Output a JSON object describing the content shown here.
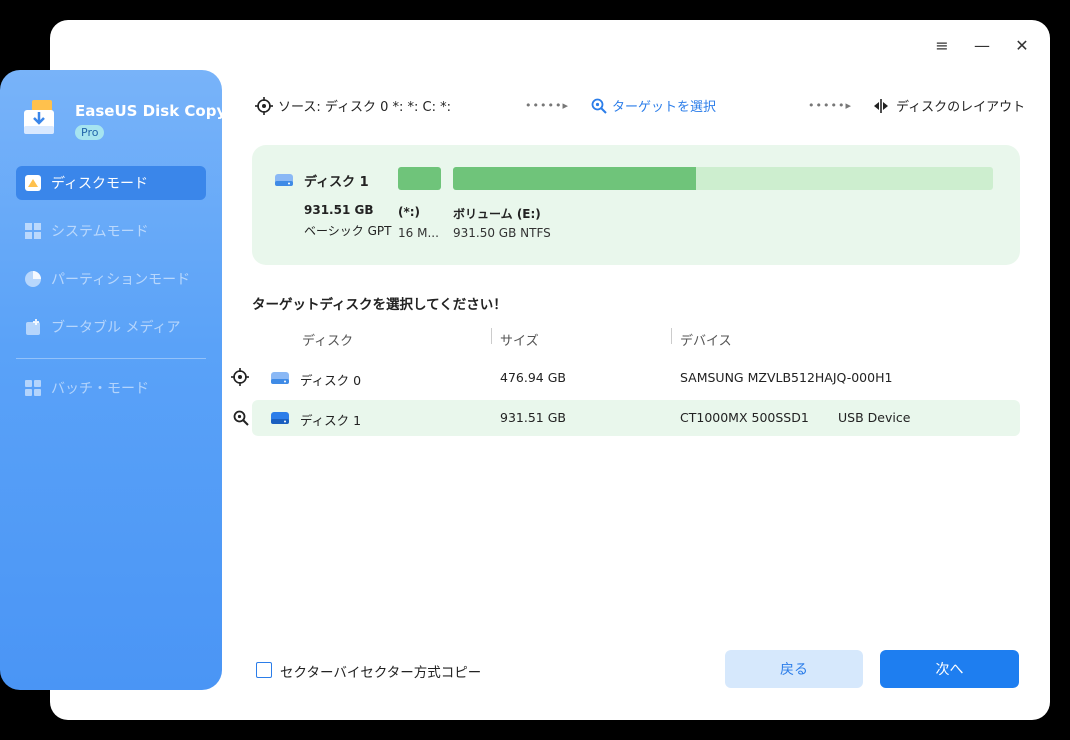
{
  "app": {
    "name": "EaseUS Disk Copy",
    "badge": "Pro"
  },
  "nav": {
    "items": [
      {
        "label": "ディスクモード",
        "icon": "disk-mode-icon"
      },
      {
        "label": "システムモード",
        "icon": "windows-icon"
      },
      {
        "label": "パーティションモード",
        "icon": "pie-icon"
      },
      {
        "label": "ブータブル メディア",
        "icon": "bootable-media-icon"
      },
      {
        "label": "バッチ・モード",
        "icon": "batch-icon"
      }
    ]
  },
  "window_controls": {
    "menu": "≡",
    "minimize": "—",
    "close": "✕"
  },
  "steps": {
    "source": "ソース: ディスク 0 *: *: C: *:",
    "target": "ターゲットを選択",
    "layout": "ディスクのレイアウト"
  },
  "source_card": {
    "disk_name": "ディスク 1",
    "size": "931.51 GB",
    "type": "ベーシック GPT",
    "partitions": [
      {
        "name": "(*:)",
        "detail": "16 M..."
      },
      {
        "name": "ボリューム (E:)",
        "detail": "931.50 GB NTFS",
        "used_fraction": 0.45
      }
    ]
  },
  "prompt": "ターゲットディスクを選択してください！",
  "table": {
    "headers": [
      "ディスク",
      "サイズ",
      "デバイス"
    ],
    "rows": [
      {
        "disk": "ディスク 0",
        "size": "476.94 GB",
        "device": "SAMSUNG MZVLB512HAJQ-000H1",
        "extra": ""
      },
      {
        "disk": "ディスク 1",
        "size": "931.51 GB",
        "device": "CT1000MX 500SSD1",
        "extra": "USB Device"
      }
    ]
  },
  "footer": {
    "sector_copy_label": "セクターバイセクター方式コピー",
    "back_label": "戻る",
    "next_label": "次へ"
  },
  "colors": {
    "accent": "#2b7de9",
    "green": "#6fc47a",
    "sidebar": "#5aa2f8"
  }
}
